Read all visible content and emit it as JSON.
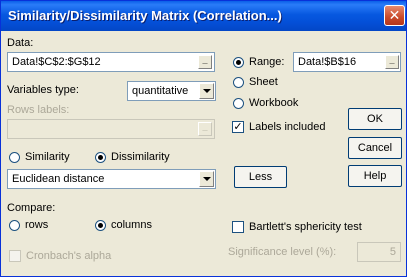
{
  "window": {
    "title": "Similarity/Dissimilarity Matrix (Correlation...)",
    "close_glyph": "✕"
  },
  "data_section": {
    "label": "Data:",
    "value": "Data!$C$2:$G$12",
    "ref_glyph": "_"
  },
  "variables_type": {
    "label": "Variables type:",
    "selected": "quantitative"
  },
  "rows_labels": {
    "label": "Rows labels:",
    "value": "",
    "ref_glyph": "_"
  },
  "measure_type": {
    "similarity_label": "Similarity",
    "dissimilarity_label": "Dissimilarity",
    "selected": "Dissimilarity"
  },
  "distance_select": {
    "selected": "Euclidean distance"
  },
  "less_button": {
    "label": "Less"
  },
  "range_option": {
    "range_label": "Range:",
    "range_value": "Data!$B$16",
    "sheet_label": "Sheet",
    "workbook_label": "Workbook",
    "selected": "Range",
    "ref_glyph": "_"
  },
  "labels_included": {
    "label": "Labels included",
    "checked": true,
    "check_glyph": "✓"
  },
  "buttons": {
    "ok": "OK",
    "cancel": "Cancel",
    "help": "Help"
  },
  "compare": {
    "label": "Compare:",
    "rows_label": "rows",
    "columns_label": "columns",
    "selected": "columns"
  },
  "bartlett": {
    "label": "Bartlett's sphericity test",
    "checked": false
  },
  "cronbach": {
    "label": "Cronbach's alpha",
    "checked": false
  },
  "significance": {
    "label": "Significance level (%):",
    "value": "5"
  },
  "colors": {
    "title_bar": "#0558e0",
    "dialog_bg": "#ece9d8",
    "close_button": "#c94a2a"
  }
}
